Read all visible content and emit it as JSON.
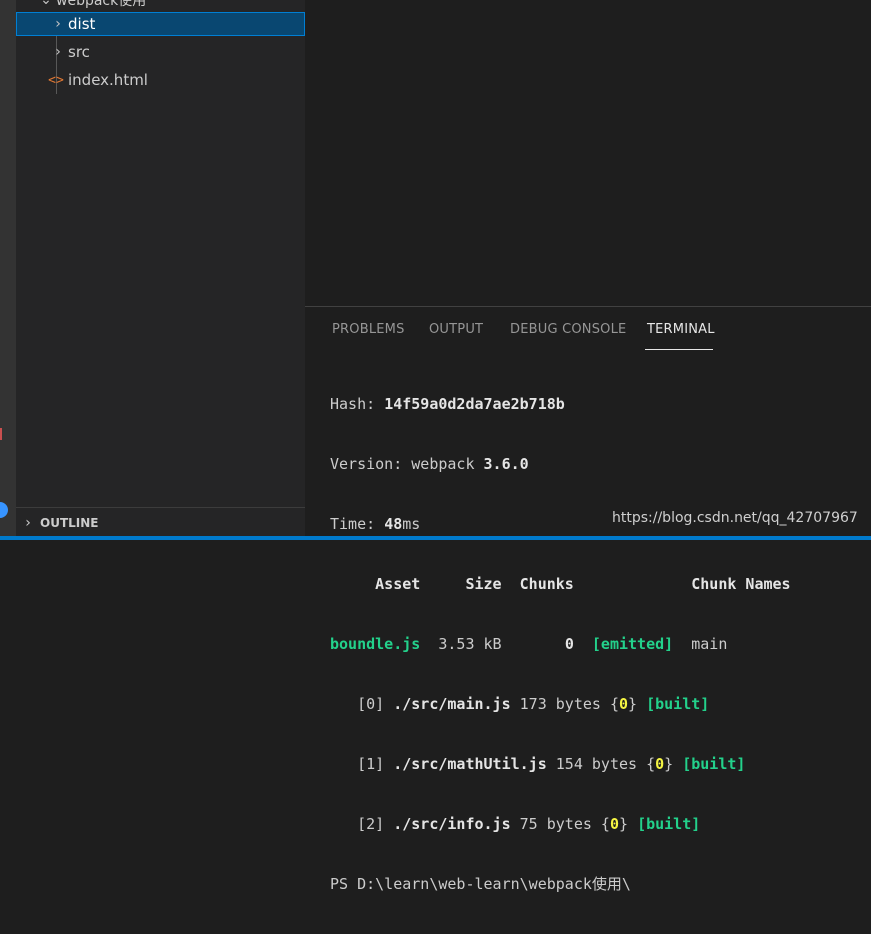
{
  "explorer": {
    "root_label": "webpack使用",
    "items": [
      {
        "label": "dist",
        "type": "folder",
        "selected": true
      },
      {
        "label": "src",
        "type": "folder",
        "selected": false
      },
      {
        "label": "index.html",
        "type": "file",
        "selected": false
      }
    ],
    "outline_label": "OUTLINE"
  },
  "panel": {
    "tabs": [
      {
        "label": "PROBLEMS"
      },
      {
        "label": "OUTPUT"
      },
      {
        "label": "DEBUG CONSOLE"
      },
      {
        "label": "TERMINAL",
        "active": true
      }
    ]
  },
  "terminal": {
    "hash_label": "Hash: ",
    "hash_value": "14f59a0d2da7ae2b718b",
    "version_label": "Version: webpack ",
    "version_value": "3.6.0",
    "time_label": "Time: ",
    "time_value": "48",
    "time_unit": "ms",
    "header_asset": "Asset",
    "header_size": "Size",
    "header_chunks": "Chunks",
    "header_chunk_names": "Chunk Names",
    "asset_name": "boundle.js",
    "asset_size": "3.53 kB",
    "asset_chunk": "0",
    "asset_status": "[emitted]",
    "asset_chunk_name": "main",
    "modules": [
      {
        "id": "[0]",
        "path": "./src/main.js",
        "size": "173 bytes",
        "chunk": "0",
        "status": "[built]"
      },
      {
        "id": "[1]",
        "path": "./src/mathUtil.js",
        "size": "154 bytes",
        "chunk": "0",
        "status": "[built]"
      },
      {
        "id": "[2]",
        "path": "./src/info.js",
        "size": "75 bytes",
        "chunk": "0",
        "status": "[built]"
      }
    ],
    "prompt": "PS D:\\learn\\web-learn\\webpack使用\\"
  },
  "watermark": "https://blog.csdn.net/qq_42707967",
  "colors": {
    "accent": "#007acc",
    "selection": "#094771",
    "terminal_green": "#23d18b",
    "terminal_yellow": "#f5f543"
  }
}
